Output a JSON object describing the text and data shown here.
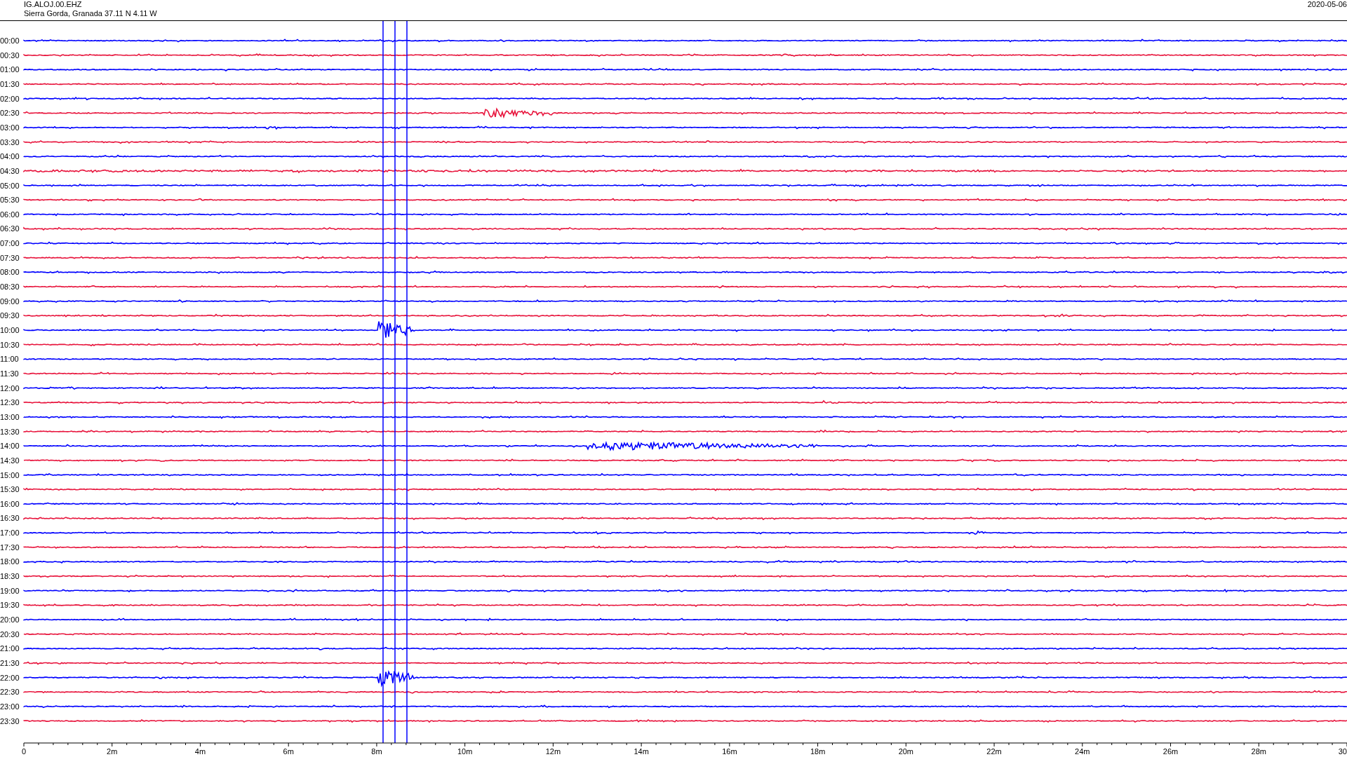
{
  "header": {
    "station": "IG.ALOJ.00.EHZ",
    "location": "Sierra Gorda, Granada  37.11 N 4.11 W",
    "date": "2020-05-06"
  },
  "rows": [
    {
      "time": "00:00",
      "color": "#0000ff"
    },
    {
      "time": "00:30",
      "color": "#e8143c"
    },
    {
      "time": "01:00",
      "color": "#0000ff"
    },
    {
      "time": "01:30",
      "color": "#e8143c"
    },
    {
      "time": "02:00",
      "color": "#0000ff"
    },
    {
      "time": "02:30",
      "color": "#e8143c"
    },
    {
      "time": "03:00",
      "color": "#0000ff"
    },
    {
      "time": "03:30",
      "color": "#e8143c"
    },
    {
      "time": "04:00",
      "color": "#0000ff"
    },
    {
      "time": "04:30",
      "color": "#e8143c"
    },
    {
      "time": "05:00",
      "color": "#0000ff"
    },
    {
      "time": "05:30",
      "color": "#e8143c"
    },
    {
      "time": "06:00",
      "color": "#0000ff"
    },
    {
      "time": "06:30",
      "color": "#e8143c"
    },
    {
      "time": "07:00",
      "color": "#0000ff"
    },
    {
      "time": "07:30",
      "color": "#e8143c"
    },
    {
      "time": "08:00",
      "color": "#0000ff"
    },
    {
      "time": "08:30",
      "color": "#e8143c"
    },
    {
      "time": "09:00",
      "color": "#0000ff"
    },
    {
      "time": "09:30",
      "color": "#e8143c"
    },
    {
      "time": "10:00",
      "color": "#0000ff"
    },
    {
      "time": "10:30",
      "color": "#e8143c"
    },
    {
      "time": "11:00",
      "color": "#0000ff"
    },
    {
      "time": "11:30",
      "color": "#e8143c"
    },
    {
      "time": "12:00",
      "color": "#0000ff"
    },
    {
      "time": "12:30",
      "color": "#e8143c"
    },
    {
      "time": "13:00",
      "color": "#0000ff"
    },
    {
      "time": "13:30",
      "color": "#e8143c"
    },
    {
      "time": "14:00",
      "color": "#0000ff"
    },
    {
      "time": "14:30",
      "color": "#e8143c"
    },
    {
      "time": "15:00",
      "color": "#0000ff"
    },
    {
      "time": "15:30",
      "color": "#e8143c"
    },
    {
      "time": "16:00",
      "color": "#0000ff"
    },
    {
      "time": "16:30",
      "color": "#e8143c"
    },
    {
      "time": "17:00",
      "color": "#0000ff"
    },
    {
      "time": "17:30",
      "color": "#e8143c"
    },
    {
      "time": "18:00",
      "color": "#0000ff"
    },
    {
      "time": "18:30",
      "color": "#e8143c"
    },
    {
      "time": "19:00",
      "color": "#0000ff"
    },
    {
      "time": "19:30",
      "color": "#e8143c"
    },
    {
      "time": "20:00",
      "color": "#0000ff"
    },
    {
      "time": "20:30",
      "color": "#e8143c"
    },
    {
      "time": "21:00",
      "color": "#0000ff"
    },
    {
      "time": "21:30",
      "color": "#e8143c"
    },
    {
      "time": "22:00",
      "color": "#0000ff"
    },
    {
      "time": "22:30",
      "color": "#e8143c"
    },
    {
      "time": "23:00",
      "color": "#0000ff"
    },
    {
      "time": "23:30",
      "color": "#e8143c"
    }
  ],
  "axis": {
    "labels": [
      "0",
      "2m",
      "4m",
      "6m",
      "8m",
      "10m",
      "12m",
      "14m",
      "16m",
      "18m",
      "20m",
      "22m",
      "24m",
      "26m",
      "28m",
      "30"
    ]
  }
}
